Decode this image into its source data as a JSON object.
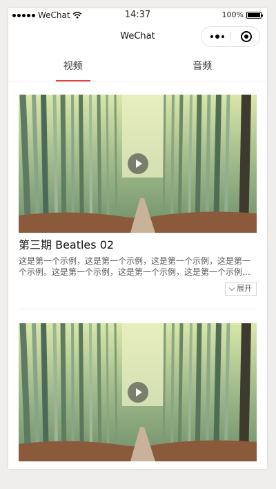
{
  "status_bar": {
    "carrier": "WeChat",
    "time": "14:37",
    "battery": "100%"
  },
  "nav": {
    "title": "WeChat",
    "more_icon": "more-dots-icon",
    "close_icon": "close-target-icon"
  },
  "tabs": [
    {
      "label": "视频",
      "active": true
    },
    {
      "label": "音频",
      "active": false
    }
  ],
  "videos": [
    {
      "title": "第三期 Beatles 02",
      "description": "这是第一个示例，这是第一个示例，这是第一个示例，这是第一个示例。这是第一个示例，这是第一个示例，这是第一个示例，这是第一个示例。",
      "expand_label": "展开",
      "thumbnail": "bamboo forest path"
    },
    {
      "thumbnail": "bamboo forest path"
    }
  ],
  "colors": {
    "accent": "#e0403d"
  }
}
